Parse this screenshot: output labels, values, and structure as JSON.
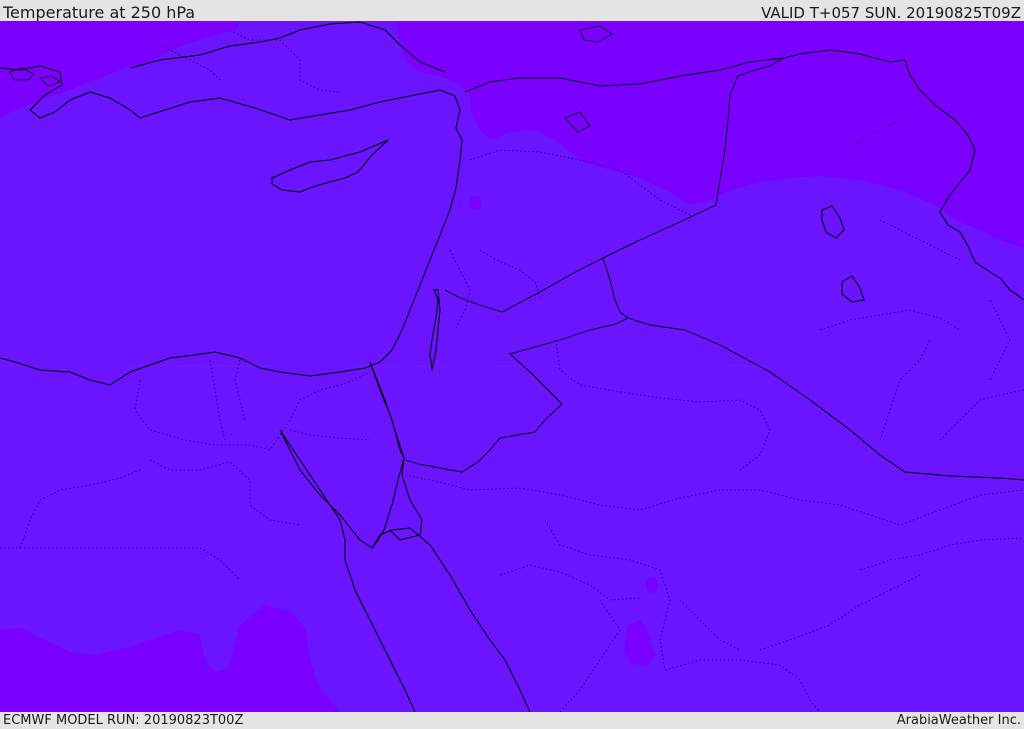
{
  "header": {
    "title": "Temperature at 250 hPa",
    "valid_time": "VALID T+057 SUN. 20190825T09Z"
  },
  "footer": {
    "model_run": "ECMWF MODEL RUN: 20190823T00Z",
    "provider": "ArabiaWeather Inc."
  },
  "map": {
    "field": "temperature",
    "pressure_level": "250 hPa",
    "colors": {
      "cold_band": "#7a00ff",
      "main_band": "#6a14ff",
      "coastline": "#000000",
      "borders": "#1a0060"
    }
  }
}
